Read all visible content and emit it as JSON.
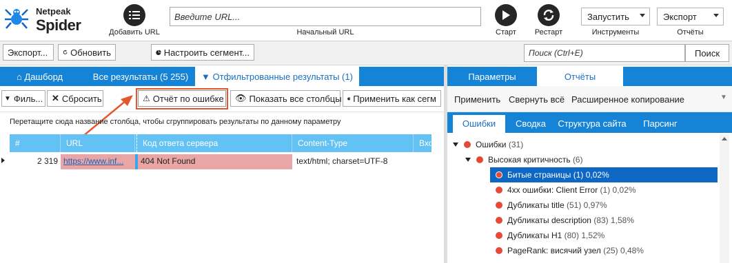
{
  "app": {
    "logo_line1": "Netpeak",
    "logo_line2": "Spider"
  },
  "toolbar": {
    "add_url_label": "Добавить URL",
    "url_placeholder": "Введите URL...",
    "url_caption": "Начальный URL",
    "start_label": "Старт",
    "restart_label": "Рестарт",
    "run_dropdown": "Запустить",
    "tools_label": "Инструменты",
    "export_dropdown": "Экспорт",
    "reports_label": "Отчёты"
  },
  "bar2": {
    "export_btn": "Экспорт...",
    "refresh_btn": "Обновить",
    "segment_btn": "Настроить сегмент...",
    "search_placeholder": "Поиск (Ctrl+E)",
    "search_btn": "Поиск"
  },
  "left_tabs": [
    {
      "label": "Дашборд"
    },
    {
      "label": "Все результаты (5 255)"
    },
    {
      "label": "Отфильтрованные результаты (1)"
    }
  ],
  "left_tools": {
    "filter": "Филь...",
    "reset": "Сбросить",
    "error_report": "Отчёт по ошибке",
    "show_columns": "Показать все столбцы",
    "apply_segment": "Применить как сегм"
  },
  "group_hint": "Перетащите сюда название столбца, чтобы сгруппировать результаты по данному параметру",
  "grid": {
    "columns": [
      "#",
      "URL",
      "Код ответа сервера",
      "Content-Type",
      "Вхо"
    ],
    "rows": [
      [
        "2 319",
        "https://www.inf...",
        "404 Not Found",
        "text/html; charset=UTF-8",
        ""
      ]
    ]
  },
  "right_tabs": [
    {
      "label": "Параметры"
    },
    {
      "label": "Отчёты"
    }
  ],
  "right_actions": {
    "apply": "Применить",
    "collapse_all": "Свернуть всё",
    "advanced_copy": "Расширенное копирование"
  },
  "right_subtabs": [
    {
      "label": "Ошибки"
    },
    {
      "label": "Сводка"
    },
    {
      "label": "Структура сайта"
    },
    {
      "label": "Парсинг"
    }
  ],
  "tree": {
    "root": {
      "name": "Ошибки",
      "count": "(31)"
    },
    "group": {
      "name": "Высокая критичность",
      "count": "(6)"
    },
    "items": [
      {
        "name": "Битые страницы",
        "stat": "(1) 0,02%"
      },
      {
        "name": "4xx ошибки: Client Error",
        "stat": "(1) 0,02%"
      },
      {
        "name": "Дубликаты title",
        "stat": "(51) 0,97%"
      },
      {
        "name": "Дубликаты description",
        "stat": "(83) 1,58%"
      },
      {
        "name": "Дубликаты H1",
        "stat": "(80) 1,52%"
      },
      {
        "name": "PageRank: висячий узел",
        "stat": "(25) 0,48%"
      }
    ]
  },
  "colors": {
    "accent_blue": "#1583d6",
    "grid_header": "#63c2f3",
    "error_dot": "#e44a35",
    "highlight": "#e2572b",
    "selection": "#0e68c3"
  }
}
